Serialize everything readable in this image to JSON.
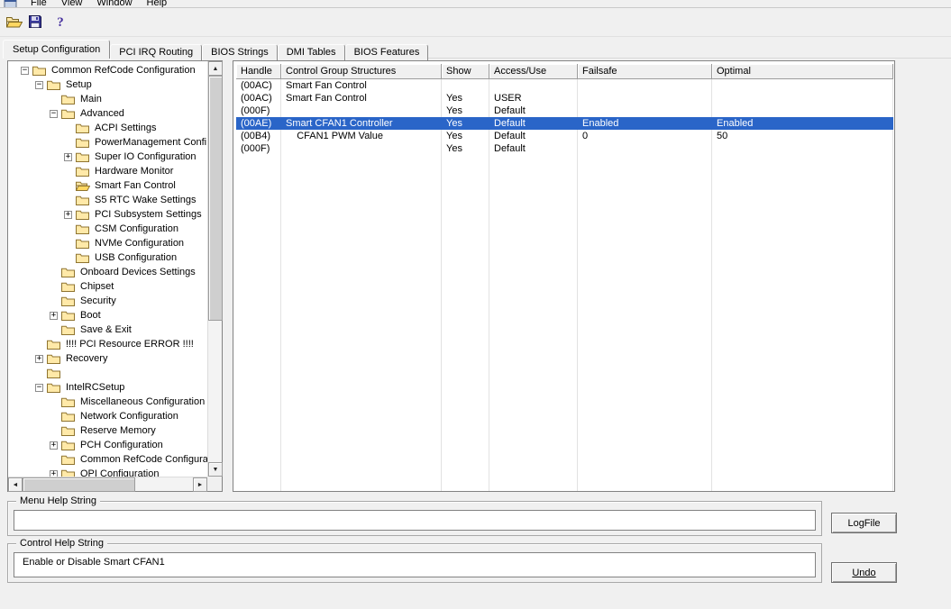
{
  "window": {
    "background": "#f0f0f0",
    "selection_color": "#2a65c8",
    "panel_color": "#ffffff"
  },
  "menubar": {
    "items": [
      "File",
      "View",
      "Window",
      "Help"
    ]
  },
  "toolbar": {
    "buttons": [
      {
        "name": "open",
        "icon": "open-folder-icon"
      },
      {
        "name": "save",
        "icon": "save-icon"
      },
      {
        "name": "help",
        "icon": "help-icon"
      }
    ]
  },
  "icons": {
    "scroll_up": "▲",
    "scroll_down": "▼",
    "scroll_left": "◄",
    "scroll_right": "►",
    "help_glyph": "?",
    "expander_plus": "+",
    "expander_minus": "−"
  },
  "tabs": {
    "active": "Setup Configuration",
    "items": [
      "Setup Configuration",
      "PCI IRQ Routing",
      "BIOS Strings",
      "DMI Tables",
      "BIOS Features"
    ]
  },
  "tree": {
    "items": [
      {
        "label": "Common RefCode Configuration",
        "level": 0,
        "expander": "minus",
        "icon": "folder"
      },
      {
        "label": "Setup",
        "level": 1,
        "expander": "minus",
        "icon": "folder"
      },
      {
        "label": "Main",
        "level": 2,
        "expander": null,
        "icon": "folder"
      },
      {
        "label": "Advanced",
        "level": 2,
        "expander": "minus",
        "icon": "folder"
      },
      {
        "label": "ACPI Settings",
        "level": 3,
        "expander": null,
        "icon": "folder"
      },
      {
        "label": "PowerManagement Confi",
        "level": 3,
        "expander": null,
        "icon": "folder"
      },
      {
        "label": "Super IO Configuration",
        "level": 3,
        "expander": "plus",
        "icon": "folder"
      },
      {
        "label": "Hardware Monitor",
        "level": 3,
        "expander": null,
        "icon": "folder"
      },
      {
        "label": "Smart Fan Control",
        "level": 3,
        "expander": null,
        "icon": "folder-open"
      },
      {
        "label": "S5 RTC Wake Settings",
        "level": 3,
        "expander": null,
        "icon": "folder"
      },
      {
        "label": "PCI Subsystem Settings",
        "level": 3,
        "expander": "plus",
        "icon": "folder"
      },
      {
        "label": "CSM Configuration",
        "level": 3,
        "expander": null,
        "icon": "folder"
      },
      {
        "label": "NVMe Configuration",
        "level": 3,
        "expander": null,
        "icon": "folder"
      },
      {
        "label": "USB Configuration",
        "level": 3,
        "expander": null,
        "icon": "folder"
      },
      {
        "label": "Onboard Devices Settings",
        "level": 2,
        "expander": null,
        "icon": "folder"
      },
      {
        "label": "Chipset",
        "level": 2,
        "expander": null,
        "icon": "folder"
      },
      {
        "label": "Security",
        "level": 2,
        "expander": null,
        "icon": "folder"
      },
      {
        "label": "Boot",
        "level": 2,
        "expander": "plus",
        "icon": "folder"
      },
      {
        "label": "Save & Exit",
        "level": 2,
        "expander": null,
        "icon": "folder"
      },
      {
        "label": "!!!! PCI Resource ERROR !!!!",
        "level": 1,
        "expander": null,
        "icon": "folder"
      },
      {
        "label": "Recovery",
        "level": 1,
        "expander": "plus",
        "icon": "folder"
      },
      {
        "label": "",
        "level": 1,
        "expander": null,
        "icon": "folder"
      },
      {
        "label": "IntelRCSetup",
        "level": 1,
        "expander": "minus",
        "icon": "folder"
      },
      {
        "label": "Miscellaneous Configuration",
        "level": 2,
        "expander": null,
        "icon": "folder"
      },
      {
        "label": "Network Configuration",
        "level": 2,
        "expander": null,
        "icon": "folder"
      },
      {
        "label": "Reserve Memory",
        "level": 2,
        "expander": null,
        "icon": "folder"
      },
      {
        "label": "PCH Configuration",
        "level": 2,
        "expander": "plus",
        "icon": "folder"
      },
      {
        "label": "Common RefCode Configurati",
        "level": 2,
        "expander": null,
        "icon": "folder"
      },
      {
        "label": "QPI Configuration",
        "level": 2,
        "expander": "plus",
        "icon": "folder"
      }
    ]
  },
  "table": {
    "columns": [
      "Handle",
      "Control Group Structures",
      "Show",
      "Access/Use",
      "Failsafe",
      "Optimal"
    ],
    "rows": [
      {
        "cells": [
          "(00AC)",
          "Smart Fan Control",
          "",
          "",
          "",
          ""
        ],
        "selected": false
      },
      {
        "cells": [
          "(00AC)",
          "Smart Fan Control",
          "Yes",
          "USER",
          "",
          ""
        ],
        "selected": false
      },
      {
        "cells": [
          "(000F)",
          "",
          "Yes",
          "Default",
          "",
          ""
        ],
        "selected": false
      },
      {
        "cells": [
          "(00AE)",
          "Smart CFAN1 Controller",
          "Yes",
          "Default",
          "Enabled",
          "Enabled"
        ],
        "selected": true
      },
      {
        "cells": [
          "(00B4)",
          "    CFAN1 PWM Value",
          "Yes",
          "Default",
          "0",
          "50"
        ],
        "selected": false
      },
      {
        "cells": [
          "(000F)",
          "",
          "Yes",
          "Default",
          "",
          ""
        ],
        "selected": false
      }
    ]
  },
  "menu_help": {
    "title": "Menu Help String",
    "text": ""
  },
  "control_help": {
    "title": "Control Help String",
    "text": "Enable or Disable Smart CFAN1"
  },
  "buttons": {
    "logfile": "LogFile",
    "undo": "Undo"
  }
}
